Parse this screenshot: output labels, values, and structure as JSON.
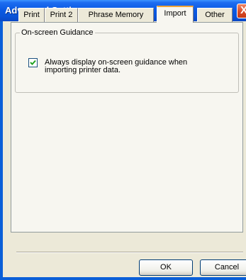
{
  "window": {
    "title": "Advanced Settings",
    "close_glyph": "X"
  },
  "tabs": [
    {
      "label": "Print"
    },
    {
      "label": "Print 2"
    },
    {
      "label": "Phrase Memory"
    },
    {
      "label": "Import",
      "active": true
    },
    {
      "label": "Other"
    }
  ],
  "guidance": {
    "group_label": "On-screen Guidance",
    "checkbox_checked": true,
    "checkbox_label": "Always display on-screen guidance when importing printer data."
  },
  "buttons": {
    "ok": "OK",
    "cancel": "Cancel"
  },
  "colors": {
    "titlebar": "#0b5ae4",
    "face": "#ece9d8",
    "panel": "#f7f6f0",
    "active_tab_accent": "#f1a53a"
  },
  "icons": {
    "close": "close-icon",
    "check": "checkmark-icon"
  }
}
